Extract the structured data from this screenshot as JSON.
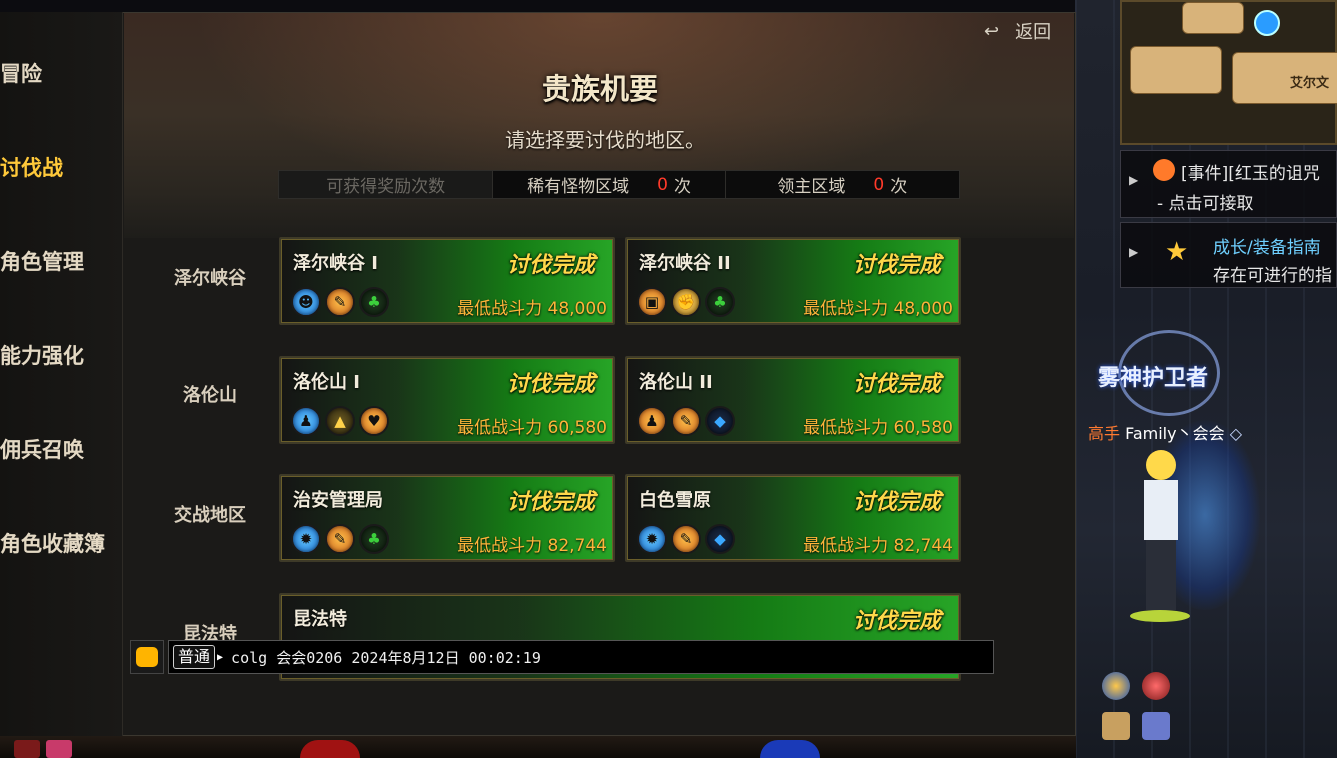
{
  "sidebar": {
    "items": [
      {
        "label": "冒险",
        "active": false
      },
      {
        "label": "讨伐战",
        "active": true
      },
      {
        "label": "角色管理",
        "active": false
      },
      {
        "label": "能力强化",
        "active": false
      },
      {
        "label": "佣兵召唤",
        "active": false
      },
      {
        "label": "角色收藏簿",
        "active": false
      }
    ]
  },
  "header": {
    "back_label": "返回",
    "title": "贵族机要",
    "subtitle": "请选择要讨伐的地区。"
  },
  "reward_bar": {
    "label": "可获得奖励次数",
    "rare_label": "稀有怪物区域",
    "rare_count": "0",
    "lord_label": "领主区域",
    "lord_count": "0",
    "unit": "次"
  },
  "regions": [
    {
      "name": "泽尔峡谷",
      "cards": [
        {
          "name": "泽尔峡谷 I",
          "status": "讨伐完成",
          "power": "最低战斗力 48,000",
          "icons": [
            "blue-mask-icon",
            "orange-feather-icon",
            "green-clover-icon"
          ]
        },
        {
          "name": "泽尔峡谷 II",
          "status": "讨伐完成",
          "power": "最低战斗力 48,000",
          "icons": [
            "orange-armor-icon",
            "gold-fist-icon",
            "green-clover-icon"
          ]
        }
      ]
    },
    {
      "name": "洛伦山",
      "cards": [
        {
          "name": "洛伦山 I",
          "status": "讨伐完成",
          "power": "最低战斗力 60,580",
          "icons": [
            "blue-figure-icon",
            "olive-boot-icon",
            "orange-heart-icon"
          ]
        },
        {
          "name": "洛伦山 II",
          "status": "讨伐完成",
          "power": "最低战斗力 60,580",
          "icons": [
            "orange-figure-icon",
            "orange-feather-icon",
            "blue-diamond-icon"
          ]
        }
      ]
    },
    {
      "name": "交战地区",
      "cards": [
        {
          "name": "治安管理局",
          "status": "讨伐完成",
          "power": "最低战斗力 82,744",
          "icons": [
            "blue-gear-icon",
            "orange-feather-icon",
            "green-clover-icon"
          ]
        },
        {
          "name": "白色雪原",
          "status": "讨伐完成",
          "power": "最低战斗力 82,744",
          "icons": [
            "blue-gear-icon",
            "orange-feather-icon",
            "blue-diamond-icon"
          ]
        }
      ]
    },
    {
      "name": "昆法特",
      "cards": [
        {
          "name": "昆法特",
          "status": "讨伐完成"
        }
      ]
    }
  ],
  "chat": {
    "channel": "普通",
    "message": "colg 会会0206 2024年8月12日 00:02:19"
  },
  "world": {
    "minimap_label": "艾尔文",
    "quest1_title": "[事件][红玉的诅咒",
    "quest1_sub": "- 点击可接取",
    "quest2_title": "成长/装备指南",
    "quest2_sub": "存在可进行的指",
    "guard_title": "雾神护卫者",
    "player_rank": "高手",
    "player_name": "Family丶会会"
  },
  "colors": {
    "accent_active": "#ffc93a",
    "status_gold": "#ffd84a",
    "power_orange": "#ffb43a",
    "count_red": "#ff3a2a",
    "card_green": "#28b428"
  }
}
